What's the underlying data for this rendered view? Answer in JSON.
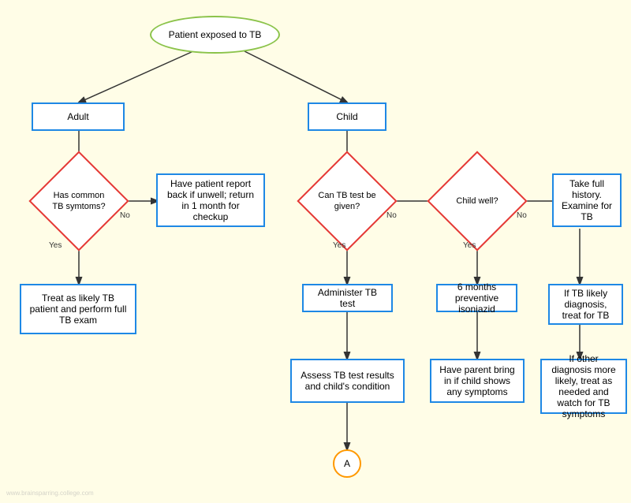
{
  "title": "Patient exposed to TB",
  "nodes": {
    "start": {
      "label": "Patient exposed to TB"
    },
    "adult": {
      "label": "Adult"
    },
    "child": {
      "label": "Child"
    },
    "diamond_adult": {
      "label": "Has common TB symtoms?"
    },
    "no_adult": {
      "label": "Have patient report back if unwell; return in 1 month for checkup"
    },
    "yes_adult": {
      "label": "Treat as likely TB patient and perform full TB exam"
    },
    "diamond_tb_test": {
      "label": "Can TB test be given?"
    },
    "diamond_child_well": {
      "label": "Child well?"
    },
    "administer_tb": {
      "label": "Administer TB test"
    },
    "assess_tb": {
      "label": "Assess TB test results and child's condition"
    },
    "preventive": {
      "label": "6 months preventive isoniazid"
    },
    "parent_bring": {
      "label": "Have parent bring in if child shows any symptoms"
    },
    "take_history": {
      "label": "Take full history. Examine for TB"
    },
    "if_tb_likely": {
      "label": "If TB likely diagnosis, treat for TB"
    },
    "other_diagnosis": {
      "label": "If other diagnosis more likely, treat as needed and watch for TB symptoms"
    },
    "circle_a": {
      "label": "A"
    }
  },
  "labels": {
    "no": "No",
    "yes": "Yes"
  }
}
